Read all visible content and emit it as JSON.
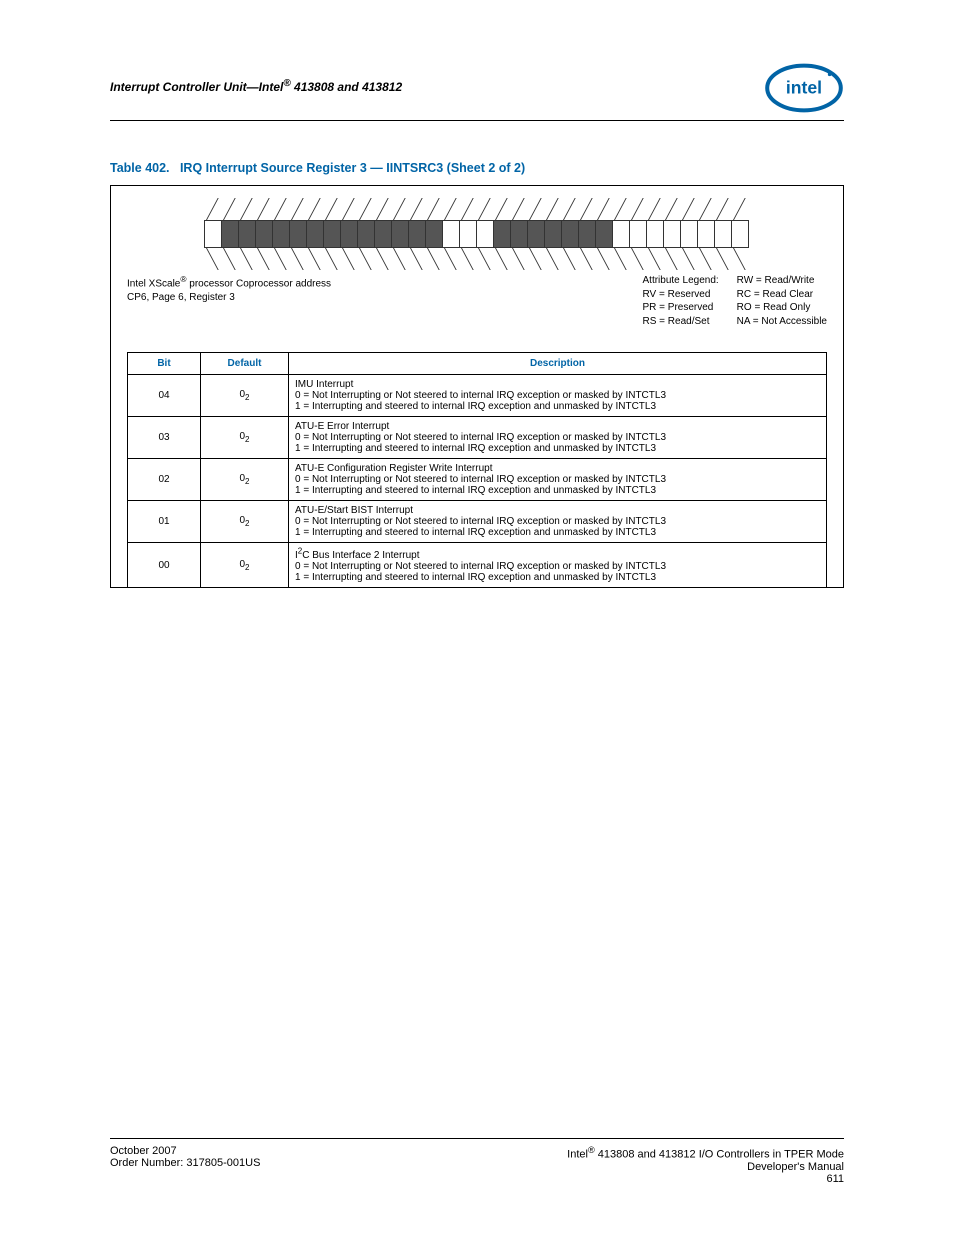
{
  "header": {
    "title_left": "Interrupt Controller Unit—Intel",
    "title_reg": "®",
    "title_right": " 413808 and 413812",
    "logo_alt": "intel"
  },
  "caption": {
    "prefix": "Table 402.",
    "text": "IRQ Interrupt Source Register 3 — IINTSRC3 (Sheet 2 of 2)"
  },
  "diagram": {
    "bit_count": 32,
    "shaded_indices": [
      1,
      2,
      3,
      4,
      5,
      6,
      7,
      8,
      9,
      10,
      11,
      12,
      13,
      17,
      18,
      19,
      20,
      21,
      22,
      23
    ]
  },
  "legend": {
    "coproc_line1_a": "Intel XScale",
    "coproc_line1_reg": "®",
    "coproc_line1_b": " processor Coprocessor address",
    "coproc_line2": "CP6, Page 6, Register 3",
    "attr_title": "Attribute Legend:",
    "attr_rv": "RV = Reserved",
    "attr_pr": "PR = Preserved",
    "attr_rs": "RS = Read/Set",
    "attr_rw": "RW = Read/Write",
    "attr_rc": "RC = Read Clear",
    "attr_ro": "RO = Read Only",
    "attr_na": "NA = Not Accessible"
  },
  "table_headers": {
    "bit": "Bit",
    "default": "Default",
    "description": "Description"
  },
  "rows": [
    {
      "bit": "04",
      "default": "0",
      "title": "IMU Interrupt",
      "line0": "0 =  Not Interrupting or Not steered to internal IRQ exception or masked by INTCTL3",
      "line1": "1 =  Interrupting and steered to internal IRQ exception and unmasked by INTCTL3"
    },
    {
      "bit": "03",
      "default": "0",
      "title": "ATU-E Error Interrupt",
      "line0": "0 =  Not Interrupting or Not steered to internal IRQ exception or masked by INTCTL3",
      "line1": "1 =  Interrupting and steered to internal IRQ exception and unmasked by INTCTL3"
    },
    {
      "bit": "02",
      "default": "0",
      "title": "ATU-E Configuration Register Write Interrupt",
      "line0": "0 =  Not Interrupting or Not steered to internal IRQ exception or masked by INTCTL3",
      "line1": "1 =  Interrupting and steered to internal IRQ exception and unmasked by INTCTL3"
    },
    {
      "bit": "01",
      "default": "0",
      "title": "ATU-E/Start BIST Interrupt",
      "line0": "0 =  Not Interrupting or Not steered to internal IRQ exception or masked by INTCTL3",
      "line1": "1 =  Interrupting and steered to internal IRQ exception and unmasked by INTCTL3"
    },
    {
      "bit": "00",
      "default": "0",
      "title_prefix": "I",
      "title_sup": "2",
      "title_suffix": "C Bus Interface 2 Interrupt",
      "line0": "0 =  Not Interrupting or Not steered to internal IRQ exception or masked by INTCTL3",
      "line1": "1 =  Interrupting and steered to internal IRQ exception and unmasked by INTCTL3"
    }
  ],
  "footer": {
    "left_line1": "October 2007",
    "left_line2": "Order Number: 317805-001US",
    "right_line1_a": "Intel",
    "right_line1_reg": "®",
    "right_line1_b": " 413808 and 413812 I/O Controllers in TPER Mode",
    "right_line2": "Developer's Manual",
    "right_line3": "611"
  }
}
